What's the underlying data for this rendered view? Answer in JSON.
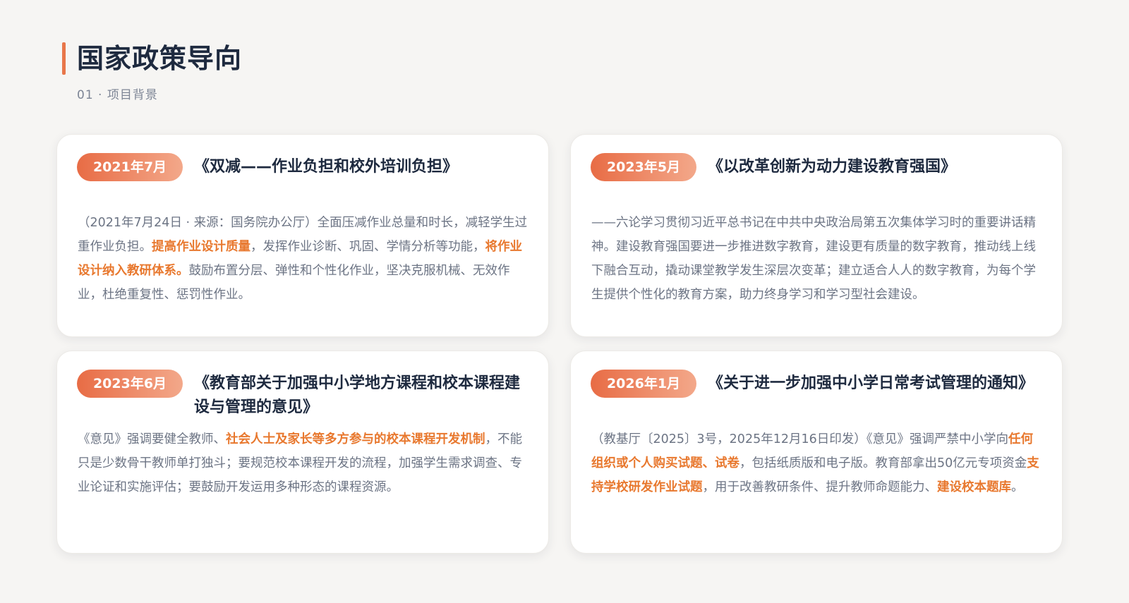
{
  "header": {
    "title": "国家政策导向",
    "subtitle": "01 · 项目背景"
  },
  "cards": [
    {
      "date": "2021年7月",
      "title": "《双减——作业负担和校外培训负担》",
      "body": [
        {
          "t": "（2021年7月24日 · 来源：国务院办公厅）全面压减作业总量和时长，减轻学生过重作业负担。",
          "hl": false
        },
        {
          "t": "提高作业设计质量",
          "hl": true
        },
        {
          "t": "，发挥作业诊断、巩固、学情分析等功能，",
          "hl": false
        },
        {
          "t": "将作业设计纳入教研体系。",
          "hl": true
        },
        {
          "t": "鼓励布置分层、弹性和个性化作业，坚决克服机械、无效作业，杜绝重复性、惩罚性作业。",
          "hl": false
        }
      ]
    },
    {
      "date": "2023年5月",
      "title": "《以改革创新为动力建设教育强国》",
      "body": [
        {
          "t": "——六论学习贯彻习近平总书记在中共中央政治局第五次集体学习时的重要讲话精神。建设教育强国要进一步推进数字教育，建设更有质量的数字教育，推动线上线下融合互动，撬动课堂教学发生深层次变革；建立适合人人的数字教育，为每个学生提供个性化的教育方案，助力终身学习和学习型社会建设。",
          "hl": false
        }
      ]
    },
    {
      "date": "2023年6月",
      "title": "《教育部关于加强中小学地方课程和校本课程建设与管理的意见》",
      "body": [
        {
          "t": "《意见》强调要健全教师、",
          "hl": false
        },
        {
          "t": "社会人士及家长等多方参与的校本课程开发机制",
          "hl": true
        },
        {
          "t": "，不能只是少数骨干教师单打独斗；要规范校本课程开发的流程，加强学生需求调查、专业论证和实施评估；要鼓励开发运用多种形态的课程资源。",
          "hl": false
        }
      ]
    },
    {
      "date": "2026年1月",
      "title": "《关于进一步加强中小学日常考试管理的通知》",
      "body": [
        {
          "t": "（教基厅〔2025〕3号，2025年12月16日印发）《意见》强调严禁中小学向",
          "hl": false
        },
        {
          "t": "任何组织或个人购买试题、试卷",
          "hl": true
        },
        {
          "t": "，包括纸质版和电子版。教育部拿出50亿元专项资金",
          "hl": false
        },
        {
          "t": "支持学校研发作业试题",
          "hl": true
        },
        {
          "t": "，用于改善教研条件、提升教师命题能力、",
          "hl": false
        },
        {
          "t": "建设校本题库",
          "hl": true
        },
        {
          "t": "。",
          "hl": false
        }
      ]
    }
  ]
}
